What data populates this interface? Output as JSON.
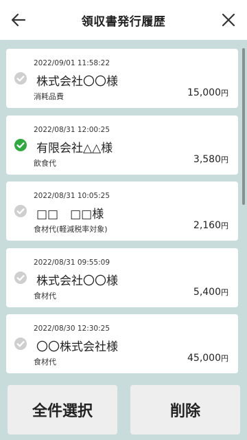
{
  "header": {
    "title": "領収書発行履歴",
    "back_icon": "arrow-left-icon",
    "close_icon": "close-icon"
  },
  "colors": {
    "background": "#c8dcdc",
    "check_active": "#2eaa3e",
    "check_inactive": "#cfcfcf"
  },
  "receipts": [
    {
      "date": "2022/09/01 11:58:22",
      "name": "株式会社〇〇様",
      "category": "消耗品費",
      "amount": "15,000",
      "currency": "円",
      "checked": false
    },
    {
      "date": "2022/08/31 12:00:25",
      "name": "有限会社△△様",
      "category": "飲食代",
      "amount": "3,580",
      "currency": "円",
      "checked": true
    },
    {
      "date": "2022/08/31 10:05:25",
      "name": "□□　□□様",
      "category": "食材代(軽減税率対象)",
      "amount": "2,160",
      "currency": "円",
      "checked": false
    },
    {
      "date": "2022/08/31 09:55:09",
      "name": "株式会社〇〇様",
      "category": "食材代",
      "amount": "5,400",
      "currency": "円",
      "checked": false
    },
    {
      "date": "2022/08/30 12:30:25",
      "name": "〇〇株式会社様",
      "category": "食材代",
      "amount": "45,000",
      "currency": "円",
      "checked": false
    }
  ],
  "footer": {
    "select_all_label": "全件選択",
    "delete_label": "削除"
  }
}
